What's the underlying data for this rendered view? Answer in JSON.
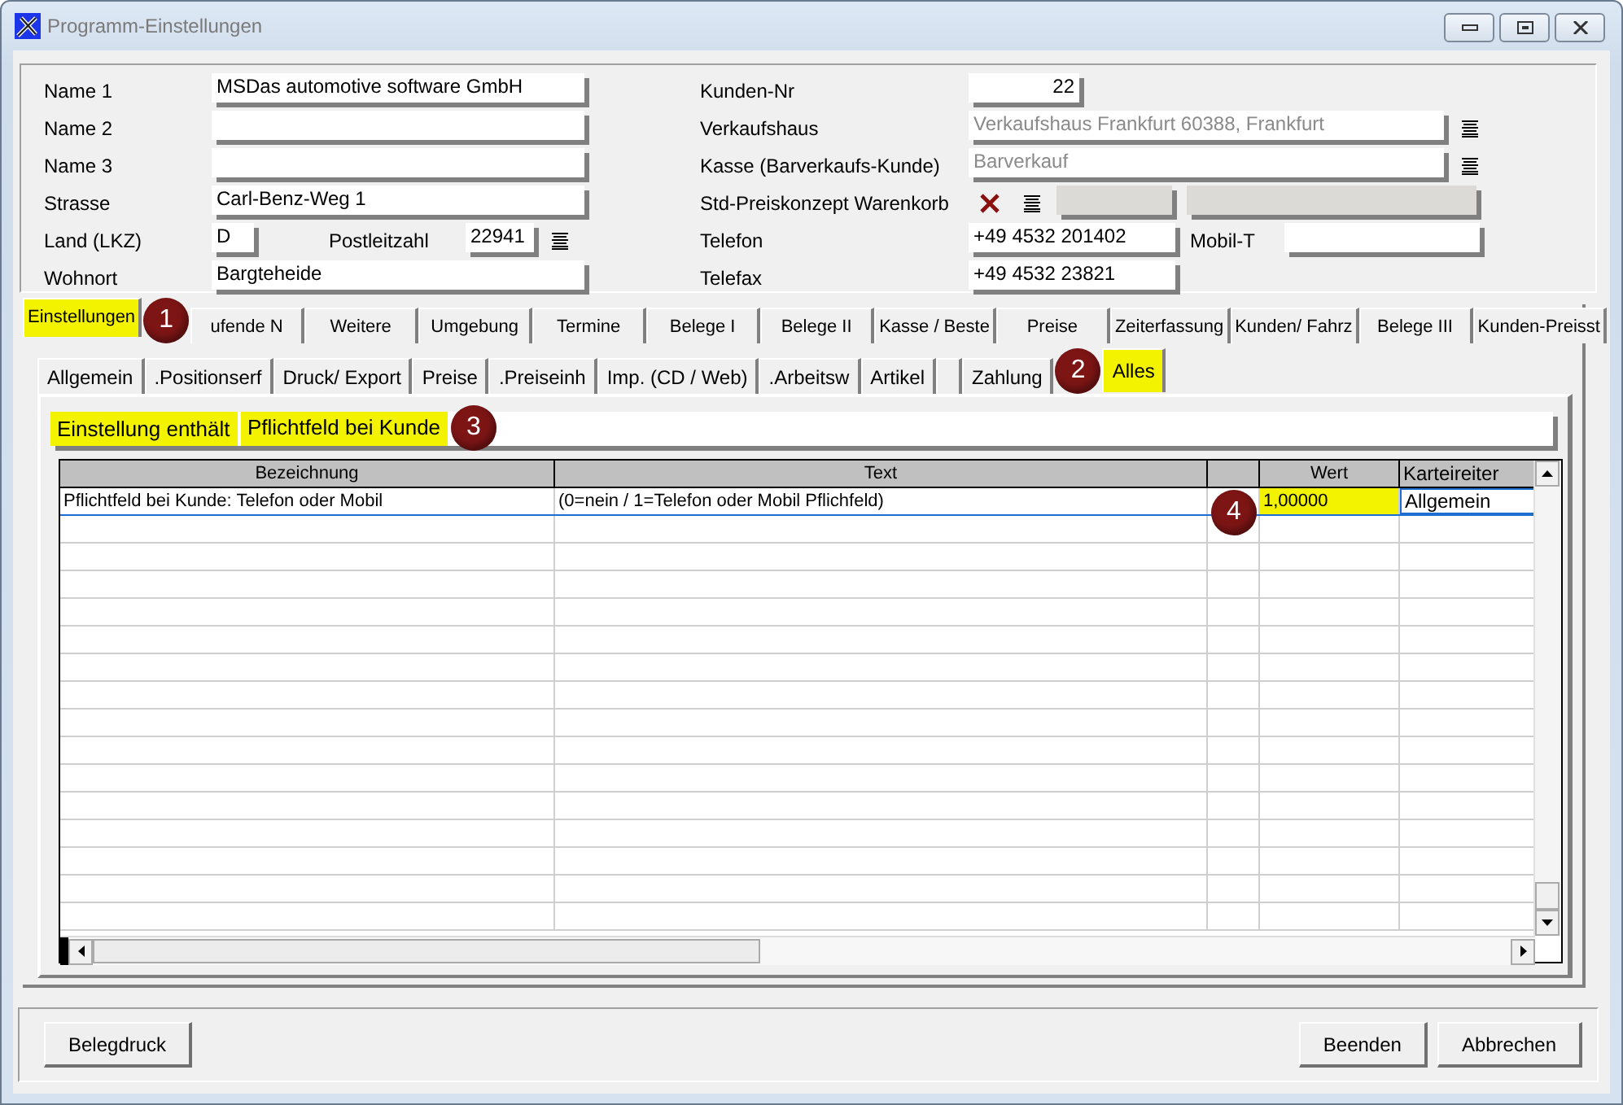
{
  "window": {
    "title": "Programm-Einstellungen"
  },
  "fields_left": [
    {
      "label": "Name 1",
      "value": "MSDas automotive software GmbH",
      "kind": "text"
    },
    {
      "label": "Name 2",
      "kind": "text"
    },
    {
      "label": "Name 3",
      "kind": "text"
    },
    {
      "label": "Strasse",
      "value": "Carl-Benz-Weg 1",
      "kind": "text"
    },
    {
      "label": "Land (LKZ)",
      "value": "D",
      "kind": "country"
    },
    {
      "label": "Wohnort",
      "value": "Bargteheide",
      "kind": "text"
    }
  ],
  "postal_code": {
    "label": "Postleitzahl",
    "value": "22941"
  },
  "fields_right": [
    {
      "label": "Kunden-Nr",
      "value": "22",
      "kind": "number",
      "disabled": false
    },
    {
      "label": "Verkaufshaus",
      "value": "Verkaufshaus Frankfurt 60388, Frankfurt",
      "kind": "lookup",
      "disabled": true
    },
    {
      "label": "Kasse (Barverkaufs-Kunde)",
      "value": "Barverkauf",
      "kind": "lookup",
      "disabled": true
    },
    {
      "label": "Std-Preiskonzept Warenkorb",
      "kind": "price_concept",
      "disabled": true
    },
    {
      "label": "Telefon",
      "value": "+49 4532 201402",
      "kind": "phone",
      "disabled": false
    },
    {
      "label": "Telefax",
      "value": "+49 4532 23821",
      "kind": "text",
      "disabled": false
    }
  ],
  "mobile": {
    "label": "Mobil-T"
  },
  "tabs_row1": [
    {
      "label": "Einstellungen",
      "selected": true,
      "highlighted": true,
      "callout": "1"
    },
    {
      "label": "ufende N",
      "selected": false,
      "highlighted": false
    },
    {
      "label": "Weitere",
      "selected": false,
      "highlighted": false
    },
    {
      "label": "Umgebung",
      "selected": false,
      "highlighted": false
    },
    {
      "label": "Termine",
      "selected": false,
      "highlighted": false
    },
    {
      "label": "Belege I",
      "selected": false,
      "highlighted": false
    },
    {
      "label": "Belege II",
      "selected": false,
      "highlighted": false
    },
    {
      "label": "Kasse / Beste",
      "selected": false,
      "highlighted": false
    },
    {
      "label": "Preise",
      "selected": false,
      "highlighted": false
    },
    {
      "label": "Zeiterfassung",
      "selected": false,
      "highlighted": false
    },
    {
      "label": "Kunden/ Fahrz",
      "selected": false,
      "highlighted": false
    },
    {
      "label": "Belege III",
      "selected": false,
      "highlighted": false
    },
    {
      "label": "Kunden-Preisst",
      "selected": false,
      "highlighted": false
    }
  ],
  "tabs_row2": [
    {
      "label": "Allgemein",
      "selected": false,
      "highlighted": false
    },
    {
      "label": ".Positionserf",
      "selected": false,
      "highlighted": false
    },
    {
      "label": "Druck/ Export",
      "selected": false,
      "highlighted": false
    },
    {
      "label": "Preise",
      "selected": false,
      "highlighted": false
    },
    {
      "label": ".Preiseinh",
      "selected": false,
      "highlighted": false
    },
    {
      "label": "Imp. (CD / Web)",
      "selected": false,
      "highlighted": false
    },
    {
      "label": ".Arbeitsw",
      "selected": false,
      "highlighted": false
    },
    {
      "label": "Artikel",
      "selected": false,
      "highlighted": false
    },
    {
      "selected": false,
      "highlighted": false
    },
    {
      "label": "Zahlung",
      "selected": false,
      "highlighted": false
    },
    {
      "label": "Alles",
      "selected": true,
      "highlighted": true,
      "callout": "2"
    }
  ],
  "filter": {
    "label": "Einstellung enthält",
    "value": "Pflichtfeld bei Kunde",
    "highlighted": true,
    "callout": "3"
  },
  "table": {
    "columns": [
      {
        "label": "Bezeichnung"
      },
      {
        "label": "Text"
      },
      {},
      {
        "label": "Wert"
      },
      {
        "label": "Karteireiter"
      }
    ],
    "rows": [
      {
        "bezeichnung": "Pflichtfeld bei Kunde: Telefon oder Mobil",
        "text": "(0=nein / 1=Telefon oder Mobil Pflichfeld)",
        "wert": "1,00000",
        "karteireiter": "Allgemein",
        "selected": true,
        "wert_highlighted": true,
        "callout": "4"
      }
    ]
  },
  "buttons": [
    {
      "label": "Belegdruck",
      "kind": "left"
    },
    {
      "label": "Beenden",
      "kind": "right"
    },
    {
      "label": "Abbrechen",
      "kind": "right"
    }
  ]
}
